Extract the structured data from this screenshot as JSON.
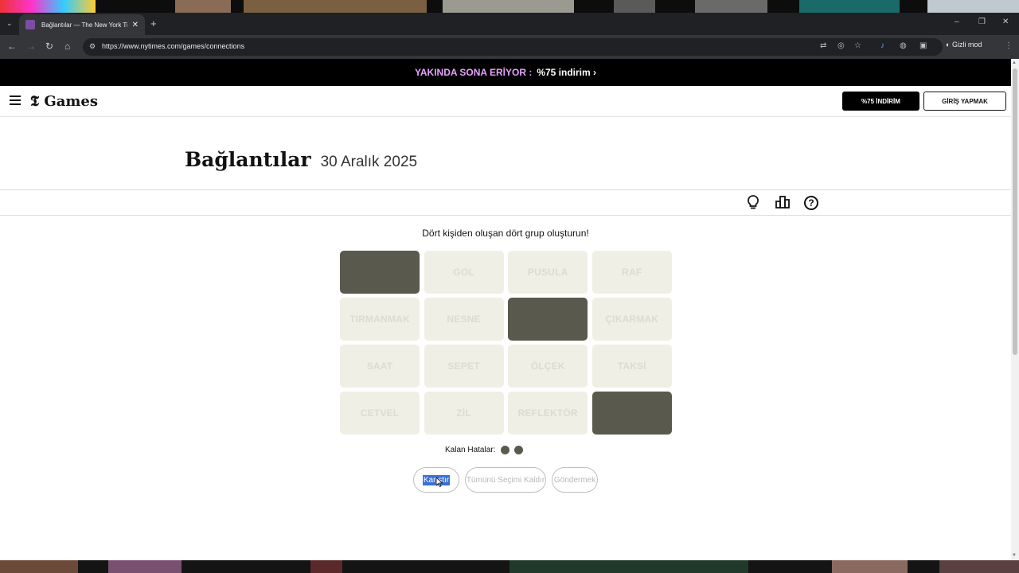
{
  "browser": {
    "tab_title": "Bağlantılar — The New York Tim",
    "url": "https://www.nytimes.com/games/connections",
    "profile_label": "Gizli mod"
  },
  "promo": {
    "highlight": "YAKINDA SONA ERİYOR :",
    "offer": "%75 indirim ›"
  },
  "header": {
    "logo": "Games",
    "subscribe_label": "%75 İNDİRİM",
    "login_label": "GİRİŞ YAPMAK"
  },
  "game": {
    "title": "Bağlantılar",
    "date": "30 Aralık 2025",
    "instruction": "Dört kişiden oluşan dört grup oluşturun!",
    "cards": [
      {
        "label": "",
        "selected": true
      },
      {
        "label": "GOL",
        "selected": false
      },
      {
        "label": "PUSULA",
        "selected": false
      },
      {
        "label": "RAF",
        "selected": false
      },
      {
        "label": "TIRMANMAK",
        "selected": false
      },
      {
        "label": "NESNE",
        "selected": false
      },
      {
        "label": "",
        "selected": true
      },
      {
        "label": "ÇIKARMAK",
        "selected": false
      },
      {
        "label": "SAAT",
        "selected": false
      },
      {
        "label": "SEPET",
        "selected": false
      },
      {
        "label": "ÖLÇEK",
        "selected": false
      },
      {
        "label": "TAKSİ",
        "selected": false
      },
      {
        "label": "CETVEL",
        "selected": false
      },
      {
        "label": "ZİL",
        "selected": false
      },
      {
        "label": "REFLEKTÖR",
        "selected": false
      },
      {
        "label": "",
        "selected": true
      }
    ],
    "mistakes_label": "Kalan Hatalar:",
    "mistakes_remaining": 2,
    "shuffle_label": "Karıştır",
    "deselect_label": "Tümünü Seçimi Kaldır",
    "submit_label": "Göndermek"
  }
}
